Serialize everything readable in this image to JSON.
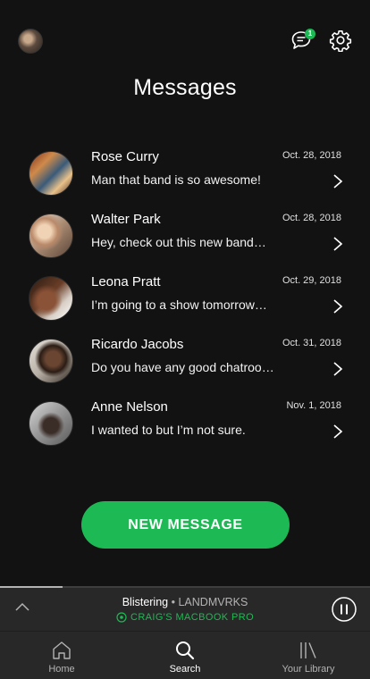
{
  "header": {
    "title": "Messages",
    "notification_count": "1"
  },
  "messages": [
    {
      "name": "Rose Curry",
      "date": "Oct. 28, 2018",
      "preview": "Man that band is so awesome!"
    },
    {
      "name": "Walter Park",
      "date": "Oct. 28, 2018",
      "preview": "Hey, check out this new band…"
    },
    {
      "name": "Leona Pratt",
      "date": "Oct. 29, 2018",
      "preview": "I’m going to a show tomorrow…"
    },
    {
      "name": "Ricardo Jacobs",
      "date": "Oct. 31, 2018",
      "preview": "Do you have any good chatrooms?"
    },
    {
      "name": "Anne Nelson",
      "date": "Nov. 1, 2018",
      "preview": "I wanted to but I’m not sure."
    }
  ],
  "new_message_label": "NEW MESSAGE",
  "now_playing": {
    "track": "Blistering",
    "separator": "•",
    "artist": "LANDMVRKS",
    "device": "CRAIG'S MACBOOK PRO",
    "progress": 0.17
  },
  "nav": {
    "home": "Home",
    "search": "Search",
    "library": "Your Library"
  },
  "colors": {
    "accent": "#1db954",
    "background": "#121212",
    "bar": "#282828"
  },
  "icons": [
    "chat-icon",
    "gear-icon",
    "chevron-right-icon",
    "chevron-up-icon",
    "speaker-icon",
    "pause-icon",
    "home-icon",
    "search-icon",
    "library-icon"
  ]
}
